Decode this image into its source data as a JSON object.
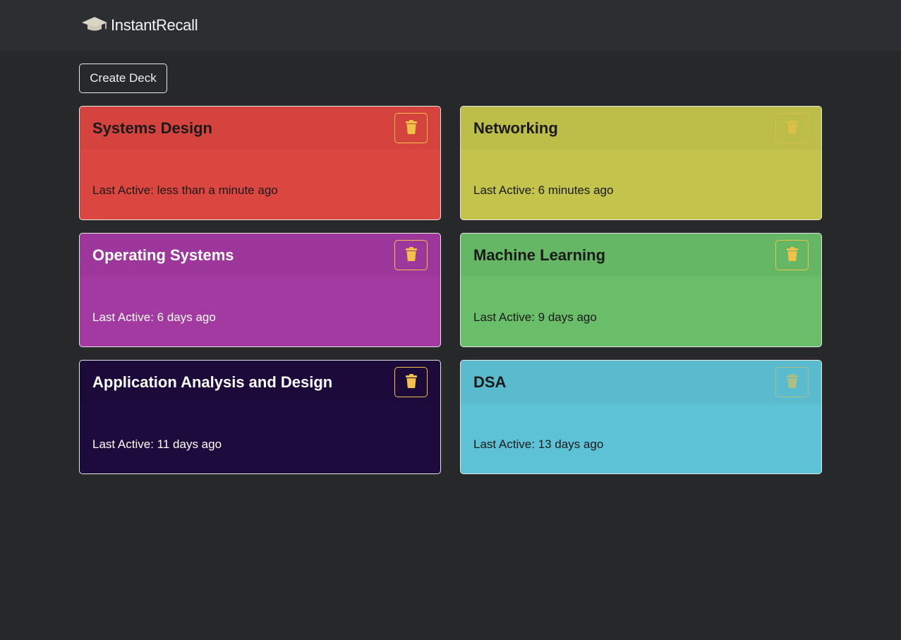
{
  "navbar": {
    "brand_icon": "graduation-cap-icon",
    "brand_name": "InstantRecall"
  },
  "toolbar": {
    "create_label": "Create Deck"
  },
  "last_active_prefix": "Last Active: ",
  "decks": [
    {
      "title": "Systems Design",
      "last_active": "less than a minute ago",
      "color": "#dc4640",
      "text_color": "#1a1a1a",
      "delete_icon": "trash-icon"
    },
    {
      "title": "Networking",
      "last_active": "6 minutes ago",
      "color": "#c4c44c",
      "text_color": "#1a1a1a",
      "delete_icon": "trash-icon"
    },
    {
      "title": "Operating Systems",
      "last_active": "6 days ago",
      "color": "#a33aa1",
      "text_color": "#ffffff",
      "delete_icon": "trash-icon"
    },
    {
      "title": "Machine Learning",
      "last_active": "9 days ago",
      "color": "#6abe69",
      "text_color": "#1a1a1a",
      "delete_icon": "trash-icon"
    },
    {
      "title": "Application Analysis and Design",
      "last_active": "11 days ago",
      "color": "#1d0b3d",
      "text_color": "#ffffff",
      "delete_icon": "trash-icon"
    },
    {
      "title": "DSA",
      "last_active": "13 days ago",
      "color": "#5ec2d7",
      "text_color": "#1a1a1a",
      "delete_icon": "trash-icon"
    }
  ],
  "colors": {
    "background": "#27282a",
    "navbar": "#2c2e32",
    "delete_accent": "#f2c14a"
  }
}
